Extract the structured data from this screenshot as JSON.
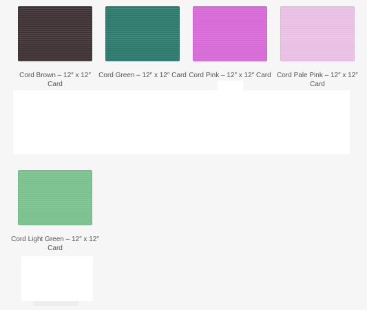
{
  "products": [
    {
      "title": "Cord Brown – 12″ x 12″ Card",
      "color": "#3f3335"
    },
    {
      "title": "Cord Green – 12″ x 12″ Card",
      "color": "#2d7a6d"
    },
    {
      "title": "Cord Pink – 12″ x 12″ Card",
      "color": "#d86ad8"
    },
    {
      "title": "Cord Pale Pink – 12″ x 12″ Card",
      "color": "#e9bfe3"
    },
    {
      "title": "Cord Light Green – 12″ x 12″ Card",
      "color": "#7bc18f"
    }
  ]
}
